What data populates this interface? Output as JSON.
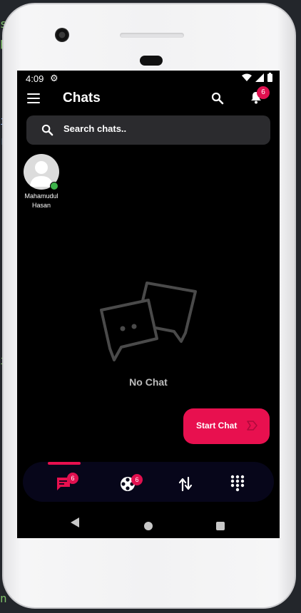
{
  "status": {
    "time": "4:09"
  },
  "appbar": {
    "title": "Chats",
    "notification_count": "6"
  },
  "search": {
    "placeholder": "Search chats.."
  },
  "online_users": [
    {
      "name": "Mahamudul Hasan"
    }
  ],
  "empty_state": {
    "label": "No Chat"
  },
  "fab": {
    "label": "Start Chat"
  },
  "bottom_nav": {
    "chats_badge": "6",
    "media_badge": "6",
    "active": "chats"
  },
  "colors": {
    "accent": "#e8104f",
    "online": "#3db24a",
    "nav_bg": "#07061a"
  }
}
